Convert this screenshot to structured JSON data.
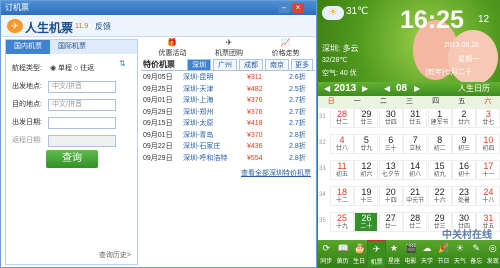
{
  "flight": {
    "window_title": "订机票",
    "app_name": "人生机票",
    "version": "11.9",
    "feedback": "反馈",
    "tabs": [
      "国内机票",
      "国际机票"
    ],
    "trip_type_label": "航程类型:",
    "oneway": "单程",
    "roundtrip": "往返",
    "from_label": "出发地点:",
    "to_label": "目的地点:",
    "depart_label": "出发日期:",
    "return_label": "返程日期:",
    "city_placeholder": "中文/拼音",
    "search_button": "查询",
    "history": "查询历史>",
    "features": [
      "优惠活动",
      "机票团购",
      "价格走势"
    ],
    "deals_title": "特价机票",
    "cities": [
      "深圳",
      "广州",
      "成都",
      "南京",
      "更多"
    ],
    "deals": [
      {
        "date": "09月05日",
        "route": "深圳-昆明",
        "price": "¥311",
        "discount": "2.6折"
      },
      {
        "date": "09月25日",
        "route": "深圳-天津",
        "price": "¥482",
        "discount": "2.5折"
      },
      {
        "date": "09月01日",
        "route": "深圳-上海",
        "price": "¥376",
        "discount": "2.7折"
      },
      {
        "date": "09月29日",
        "route": "深圳-郑州",
        "price": "¥376",
        "discount": "2.7折"
      },
      {
        "date": "09月15日",
        "route": "深圳-太原",
        "price": "¥418",
        "discount": "2.7折"
      },
      {
        "date": "09月01日",
        "route": "深圳-青岛",
        "price": "¥370",
        "discount": "2.8折"
      },
      {
        "date": "09月22日",
        "route": "深圳-石家庄",
        "price": "¥436",
        "discount": "2.8折"
      },
      {
        "date": "09月29日",
        "route": "深圳-呼和浩特",
        "price": "¥554",
        "discount": "2.8折"
      }
    ],
    "view_all": "查看全部深圳特价机票"
  },
  "calendar": {
    "temp": "31℃",
    "time": "16:25",
    "seconds": "12",
    "city": "深圳: 多云",
    "range": "32/28℃",
    "pm": "空气: 40 优",
    "date": "2013.08.26",
    "weekday": "星期一",
    "lunar": "[蛇年]七月二十",
    "year": "2013",
    "month": "08",
    "label": "人生日历",
    "weekdays": [
      "日",
      "一",
      "二",
      "三",
      "四",
      "五",
      "六"
    ],
    "week_nums": [
      "31",
      "32",
      "33",
      "34",
      "35"
    ],
    "days": [
      [
        "28",
        "廿二"
      ],
      [
        "29",
        "廿三"
      ],
      [
        "30",
        "廿四"
      ],
      [
        "31",
        "廿五"
      ],
      [
        "1",
        "建军节"
      ],
      [
        "2",
        "廿六"
      ],
      [
        "3",
        "廿七"
      ],
      [
        "4",
        "廿八"
      ],
      [
        "5",
        "廿九"
      ],
      [
        "6",
        "三十"
      ],
      [
        "7",
        "立秋"
      ],
      [
        "8",
        "初二"
      ],
      [
        "9",
        "初三"
      ],
      [
        "10",
        "初四"
      ],
      [
        "11",
        "初五"
      ],
      [
        "12",
        "初六"
      ],
      [
        "13",
        "七夕节"
      ],
      [
        "14",
        "初八"
      ],
      [
        "15",
        "初九"
      ],
      [
        "16",
        "初十"
      ],
      [
        "17",
        "十一"
      ],
      [
        "18",
        "十二"
      ],
      [
        "19",
        "十三"
      ],
      [
        "20",
        "十四"
      ],
      [
        "21",
        "中元节"
      ],
      [
        "22",
        "十六"
      ],
      [
        "23",
        "处暑"
      ],
      [
        "24",
        "十八"
      ],
      [
        "25",
        "十九"
      ],
      [
        "26",
        "二十"
      ],
      [
        "27",
        "廿一"
      ],
      [
        "28",
        "廿二"
      ],
      [
        "29",
        "廿三"
      ],
      [
        "30",
        "廿四"
      ],
      [
        "31",
        "廿五"
      ]
    ],
    "toolbar": [
      "同步",
      "黄历",
      "生日",
      "机票",
      "星座",
      "电影",
      "天学",
      "节日",
      "天气",
      "备忘",
      "发现"
    ],
    "watermark": "中关村在线"
  }
}
